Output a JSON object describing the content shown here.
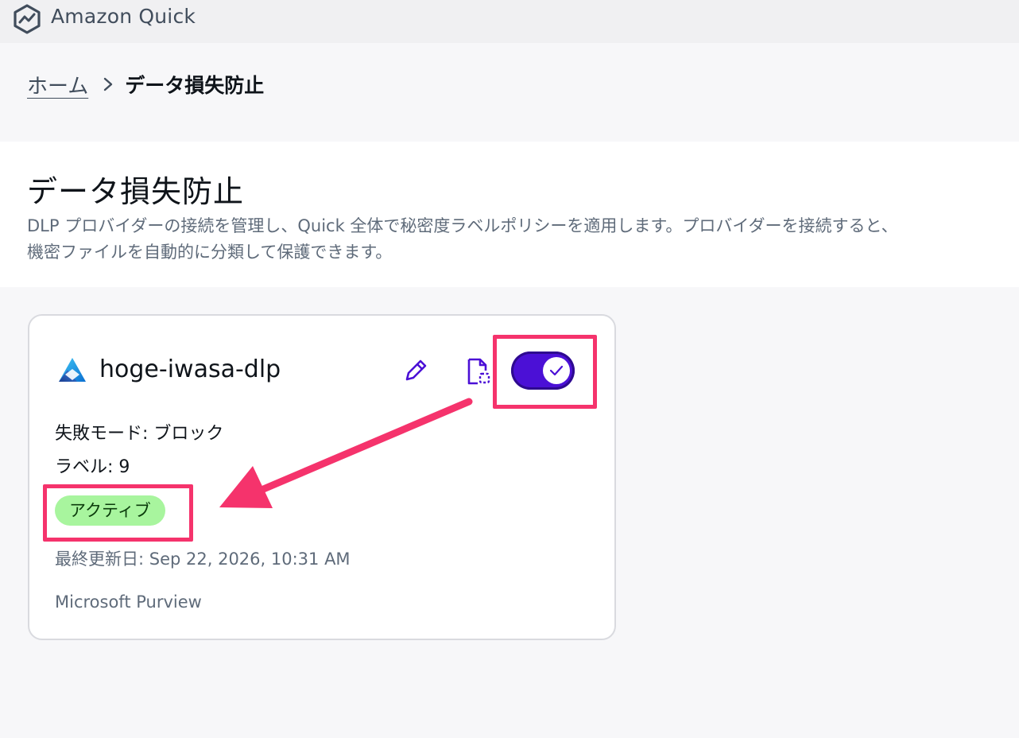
{
  "app": {
    "title": "Amazon Quick",
    "logo_icon": "hexagon-chart-logo-icon"
  },
  "breadcrumb": {
    "home": "ホーム",
    "separator_icon": "chevron-right-icon",
    "current": "データ損失防止"
  },
  "page": {
    "title": "データ損失防止",
    "description": "DLP プロバイダーの接続を管理し、Quick 全体で秘密度ラベルポリシーを適用します。プロバイダーを接続すると、\n機密ファイルを自動的に分類して保護できます。"
  },
  "card": {
    "name": "hoge-iwasa-dlp",
    "provider_logo": "microsoft-purview-logo-icon",
    "edit_icon": "pencil-icon",
    "details_icon": "document-icon",
    "toggle_on": true,
    "mode": "失敗モード: ブロック",
    "labels": "ラベル: 9",
    "status": "アクティブ",
    "updated": "最終更新日: Sep 22, 2026, 10:31 AM",
    "provider": "Microsoft Purview"
  },
  "colors": {
    "accent": "#4b10d6",
    "status_green": "#a8f59e",
    "annotation": "#f5336c"
  }
}
